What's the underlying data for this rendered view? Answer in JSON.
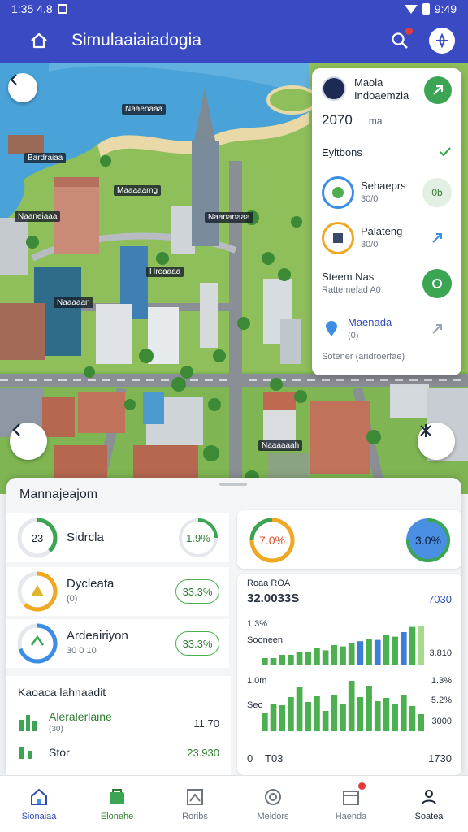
{
  "status_bar": {
    "time": "1:35 4.8",
    "right_text": "9:49"
  },
  "app_bar": {
    "title": "Simulaaiaiadogia"
  },
  "map": {
    "labels": [
      "Naaneiaaa",
      "Naananaaa",
      "Hreaaaa",
      "Naaaaan",
      "Maaaaamg",
      "Bardraiaa",
      "Naaaaaah",
      "Naaenaaa"
    ]
  },
  "side_panel": {
    "city_name_1": "Maola",
    "city_name_2": "Indoaemzia",
    "year": "2070",
    "year_unit": "ma",
    "section": "Eyltbons",
    "items": [
      {
        "title": "Sehaeprs",
        "sub": "30/0",
        "end": "0b"
      },
      {
        "title": "Palateng",
        "sub": "30/0"
      },
      {
        "title": "Steem Nas",
        "sub": "Rattemefad A0"
      },
      {
        "title": "Maenada",
        "sub": "(0)"
      }
    ],
    "note": "Sotener (aridroerfae)"
  },
  "sheet": {
    "title": "Mannajeajom",
    "stats": [
      {
        "ring_value": "23",
        "label": "Sidrcla",
        "badge": "1.9%",
        "pct": 0.38,
        "color": "#3ba553"
      },
      {
        "label": "Dycleata",
        "sub": "(0)",
        "badge": "33.3%",
        "pct": 0.62,
        "color": "#f0a823"
      },
      {
        "label": "Ardeairiyon",
        "sub": "30 0 10",
        "badge": "33.3%",
        "pct": 0.7,
        "color": "#3c8de6"
      }
    ],
    "top_right": {
      "left_ring": "7.0%",
      "right_ring": "3.0%",
      "right_pct": 0.75
    },
    "management": {
      "heading": "Kaoaca lahnaadit",
      "rows": [
        {
          "label": "Aleralerlaine",
          "sub": "(30)",
          "value": "11.70"
        },
        {
          "label": "Stor",
          "value": "23.930"
        }
      ]
    },
    "chart_card": {
      "header": "Roaa ROA",
      "big_value": "32.0033S",
      "big_right": "7030",
      "mid_label": "1.3%",
      "mid_sub": "Sooneen",
      "mid_right": "3.810",
      "low_label": "1.0m",
      "low_sub": "Seo",
      "low_right_1": "1.3%",
      "low_right_2": "5.2%",
      "low_right_3": "3000",
      "foot_left": "0",
      "foot_mid": "T03",
      "foot_right": "1730"
    }
  },
  "chart_data": [
    {
      "type": "bar",
      "values": [
        1,
        1,
        1.5,
        1.5,
        2,
        2,
        2.5,
        2.2,
        3,
        2.8,
        3.3,
        3.6,
        4,
        3.8,
        4.6,
        4.3,
        5,
        5.8,
        6
      ],
      "ylim": [
        0,
        7
      ],
      "title": "",
      "xlabel": "",
      "ylabel": ""
    },
    {
      "type": "bar",
      "values": [
        2.2,
        3.3,
        3.2,
        4.2,
        5.5,
        3.6,
        4.3,
        2.5,
        4.4,
        3.3,
        6.2,
        4.2,
        5.6,
        3.7,
        4.1,
        3.3,
        4.5,
        3.1,
        2.1
      ],
      "ylim": [
        0,
        7
      ],
      "title": "",
      "xlabel": "",
      "ylabel": ""
    }
  ],
  "bottom_nav": {
    "items": [
      {
        "label": "Sionaiaa",
        "icon": "home-icon"
      },
      {
        "label": "Elonehe",
        "icon": "shop-icon"
      },
      {
        "label": "Roribs",
        "icon": "map-icon"
      },
      {
        "label": "Meldors",
        "icon": "globe-icon"
      },
      {
        "label": "Haenda",
        "icon": "calendar-icon"
      },
      {
        "label": "Soatea",
        "icon": "profile-icon"
      }
    ]
  }
}
